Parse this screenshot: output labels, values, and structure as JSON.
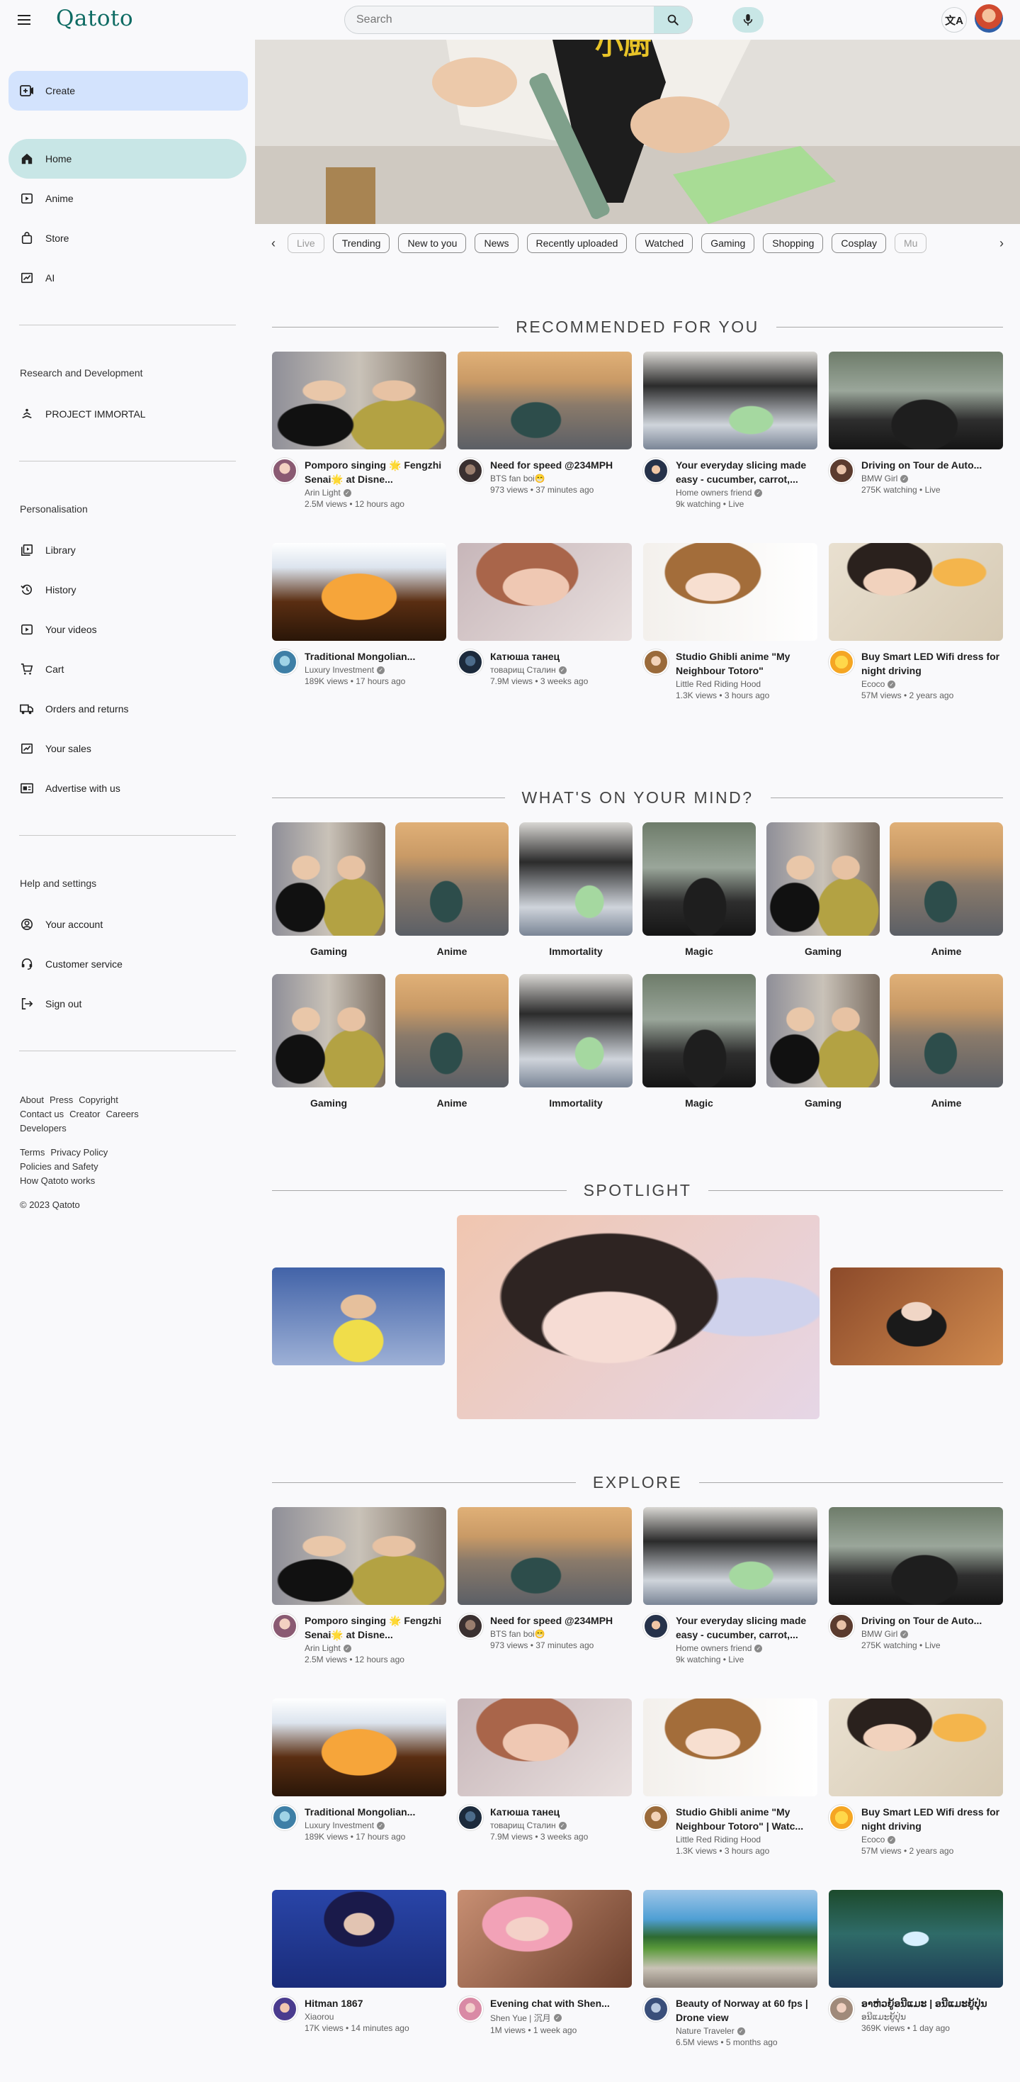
{
  "header": {
    "logo": "Qatoto",
    "search_placeholder": "Search"
  },
  "sidebar": {
    "create_label": "Create",
    "main_items": [
      {
        "label": "Home",
        "icon": "home-icon"
      },
      {
        "label": "Anime",
        "icon": "play-icon"
      },
      {
        "label": "Store",
        "icon": "bag-icon"
      },
      {
        "label": "AI",
        "icon": "chart-icon"
      }
    ],
    "rnd_title": "Research and  Development",
    "rnd_items": [
      {
        "label": "PROJECT IMMORTAL",
        "icon": "meditation-icon"
      }
    ],
    "personal_title": "Personalisation",
    "personal_items": [
      {
        "label": "Library",
        "icon": "library-icon"
      },
      {
        "label": "History",
        "icon": "history-icon"
      },
      {
        "label": "Your videos",
        "icon": "play-icon"
      },
      {
        "label": "Cart",
        "icon": "cart-icon"
      },
      {
        "label": "Orders and returns",
        "icon": "truck-icon"
      },
      {
        "label": "Your sales",
        "icon": "chart-icon"
      },
      {
        "label": "Advertise with us",
        "icon": "ad-icon"
      }
    ],
    "help_title": "Help and settings",
    "help_items": [
      {
        "label": "Your account",
        "icon": "account-icon"
      },
      {
        "label": "Customer service",
        "icon": "support-icon"
      },
      {
        "label": "Sign out",
        "icon": "signout-icon"
      }
    ],
    "footer_row1": [
      "About",
      "Press",
      "Copyright"
    ],
    "footer_row2": [
      "Contact us",
      "Creator",
      "Careers"
    ],
    "footer_row3": [
      "Developers"
    ],
    "footer_row4": [
      "Terms",
      "Privacy Policy"
    ],
    "footer_row5": [
      "Policies and Safety"
    ],
    "footer_row6": [
      "How Qatoto works"
    ],
    "copyright": "© 2023 Qatoto"
  },
  "chips": [
    "Live",
    "Trending",
    "New to you",
    "News",
    "Recently uploaded",
    "Watched",
    "Gaming",
    "Shopping",
    "Cosplay",
    "Mu"
  ],
  "sections": {
    "recommended": "RECOMMENDED FOR YOU",
    "mind": "WHAT'S ON YOUR MIND?",
    "spotlight": "SPOTLIGHT",
    "explore": "EXPLORE"
  },
  "videos": [
    {
      "title": "Pomporo singing 🌟 Fengzhi Senai🌟 at Disne...",
      "channel": "Arin Light",
      "verified": true,
      "stats": "2.5M views  •  12 hours ago",
      "thumb": "t-singer",
      "avatar": "av-1"
    },
    {
      "title": "Need for speed @234MPH",
      "channel": "BTS fan boi😁",
      "verified": false,
      "stats": "973 views  •  37 minutes ago",
      "thumb": "t-car",
      "avatar": "av-2"
    },
    {
      "title": "Your everyday slicing made easy - cucumber, carrot,...",
      "channel": "Home owners friend",
      "verified": true,
      "stats": "9k watching  •  Live",
      "thumb": "t-slice",
      "avatar": "av-3"
    },
    {
      "title": "Driving on Tour de Auto...",
      "channel": "BMW Girl",
      "verified": true,
      "stats": "275K watching  •  Live",
      "thumb": "t-drive",
      "avatar": "av-4"
    },
    {
      "title": "Traditional Mongolian...",
      "channel": "Luxury Investment",
      "verified": true,
      "stats": "189K views  •  17 hours ago",
      "thumb": "t-mongol",
      "avatar": "av-5"
    },
    {
      "title": "Катюша танец",
      "channel": "товарищ Сталин",
      "verified": true,
      "stats": "7.9M views  •  3 weeks ago",
      "thumb": "t-katya",
      "avatar": "av-6"
    },
    {
      "title": "Studio Ghibli anime \"My Neighbour Totoro\"",
      "channel": "Little Red Riding Hood",
      "verified": false,
      "stats": "1.3K views  •  3 hours ago",
      "thumb": "t-ghibli",
      "avatar": "av-7"
    },
    {
      "title": "Buy Smart LED Wifi dress for night driving",
      "channel": "Ecoco",
      "verified": true,
      "stats": "57M views  •  2 years ago",
      "thumb": "t-led",
      "avatar": "av-8"
    }
  ],
  "explore_videos": [
    {
      "title": "Pomporo singing 🌟 Fengzhi Senai🌟 at Disne...",
      "channel": "Arin Light",
      "verified": true,
      "stats": "2.5M views  •  12 hours ago",
      "thumb": "t-singer",
      "avatar": "av-1"
    },
    {
      "title": "Need for speed @234MPH",
      "channel": "BTS fan boi😁",
      "verified": false,
      "stats": "973 views  •  37 minutes ago",
      "thumb": "t-car",
      "avatar": "av-2"
    },
    {
      "title": "Your everyday slicing made easy - cucumber, carrot,...",
      "channel": "Home owners friend",
      "verified": true,
      "stats": "9k watching  •  Live",
      "thumb": "t-slice",
      "avatar": "av-3"
    },
    {
      "title": "Driving on Tour de Auto...",
      "channel": "BMW Girl",
      "verified": true,
      "stats": "275K watching  •  Live",
      "thumb": "t-drive",
      "avatar": "av-4"
    },
    {
      "title": "Traditional Mongolian...",
      "channel": "Luxury Investment",
      "verified": true,
      "stats": "189K views  •  17 hours ago",
      "thumb": "t-mongol",
      "avatar": "av-5"
    },
    {
      "title": "Катюша танец",
      "channel": "товарищ Сталин",
      "verified": true,
      "stats": "7.9M views  •  3 weeks ago",
      "thumb": "t-katya",
      "avatar": "av-6"
    },
    {
      "title": "Studio Ghibli anime \"My Neighbour Totoro\" | Watc...",
      "channel": "Little Red Riding Hood",
      "verified": false,
      "stats": "1.3K views  •  3 hours ago",
      "thumb": "t-ghibli",
      "avatar": "av-7"
    },
    {
      "title": "Buy Smart LED Wifi dress for night driving",
      "channel": "Ecoco",
      "verified": true,
      "stats": "57M views  •  2 years ago",
      "thumb": "t-led",
      "avatar": "av-8"
    },
    {
      "title": "Hitman 1867",
      "channel": "Xiaorou",
      "verified": false,
      "stats": "17K views  •  14 minutes ago",
      "thumb": "t-hitman",
      "avatar": "av-9"
    },
    {
      "title": "Evening chat with Shen...",
      "channel": "Shen Yue | 沉月",
      "verified": true,
      "stats": "1M views  •  1 week ago",
      "thumb": "t-evening",
      "avatar": "av-10"
    },
    {
      "title": "Beauty of Norway at 60 fps | Drone view",
      "channel": "Nature Traveler",
      "verified": true,
      "stats": "6.5M views  •  5 months ago",
      "thumb": "t-norway",
      "avatar": "av-11"
    },
    {
      "title": "ອາຫ່ວຍູ້ອນີແມະ | ອນີແມະຍູ້ປຸ່ນ",
      "channel": "ອນີແມະຍູ້ປຸ່ນ",
      "verified": false,
      "stats": "369K views  •  1 day ago",
      "thumb": "t-lao",
      "avatar": "av-12"
    }
  ],
  "topics": [
    {
      "label": "Gaming",
      "thumb": "t-singer"
    },
    {
      "label": "Anime",
      "thumb": "t-car"
    },
    {
      "label": "Immortality",
      "thumb": "t-slice"
    },
    {
      "label": "Magic",
      "thumb": "t-drive"
    },
    {
      "label": "Gaming",
      "thumb": "t-singer"
    },
    {
      "label": "Anime",
      "thumb": "t-car"
    },
    {
      "label": "Gaming",
      "thumb": "t-singer"
    },
    {
      "label": "Anime",
      "thumb": "t-car"
    },
    {
      "label": "Immortality",
      "thumb": "t-slice"
    },
    {
      "label": "Magic",
      "thumb": "t-drive"
    },
    {
      "label": "Gaming",
      "thumb": "t-singer"
    },
    {
      "label": "Anime",
      "thumb": "t-car"
    }
  ],
  "colors": {
    "accent": "#0e6b63",
    "active": "#c8e6e6",
    "create": "#d3e3fd"
  }
}
